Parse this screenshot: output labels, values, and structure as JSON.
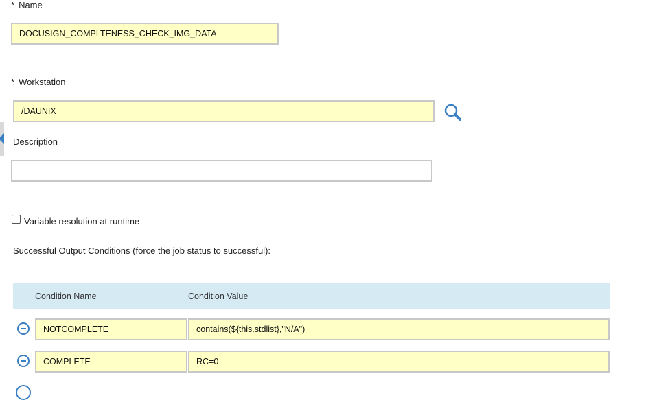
{
  "form": {
    "name_label": "Name",
    "name_value": "DOCUSIGN_COMPLTENESS_CHECK_IMG_DATA",
    "workstation_label": "Workstation",
    "workstation_value": "/DAUNIX",
    "description_label": "Description",
    "description_value": "",
    "variable_resolution_label": "Variable resolution at runtime",
    "variable_resolution_checked": false,
    "success_conditions_label": "Successful Output Conditions (force the job status to successful):"
  },
  "required_marker": "*",
  "conditions_table": {
    "columns": [
      "Condition Name",
      "Condition Value"
    ],
    "rows": [
      {
        "name": "NOTCOMPLETE",
        "value": "contains(${this.stdlist},\"N/A\")"
      },
      {
        "name": "COMPLETE",
        "value": "RC=0"
      }
    ]
  },
  "colors": {
    "field_background": "#ffffc6",
    "table_header": "#d6eaf3",
    "accent": "#3b7fc4"
  },
  "icons": [
    "search-icon",
    "remove-condition-icon",
    "add-condition-icon",
    "collapse-panel-icon"
  ]
}
